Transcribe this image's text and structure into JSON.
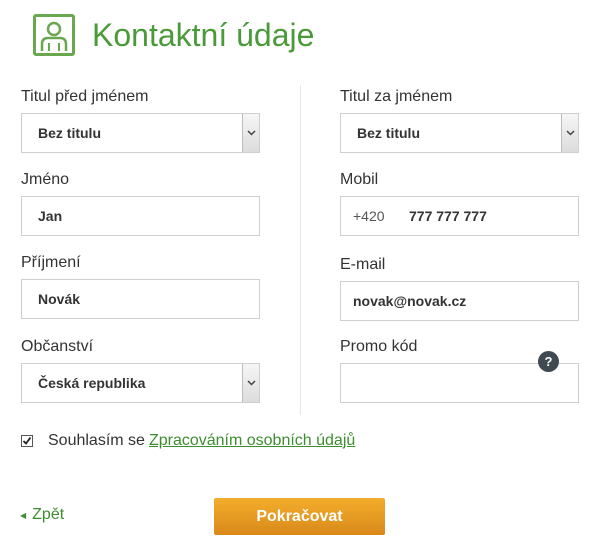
{
  "header": {
    "title": "Kontaktní údaje",
    "icon": "user-icon"
  },
  "form": {
    "title_before": {
      "label": "Titul před jménem",
      "value": "Bez titulu"
    },
    "title_after": {
      "label": "Titul za jménem",
      "value": "Bez titulu"
    },
    "first_name": {
      "label": "Jméno",
      "value": "Jan"
    },
    "mobile": {
      "label": "Mobil",
      "prefix": "+420",
      "value": "777 777 777"
    },
    "last_name": {
      "label": "Příjmení",
      "value": "Novák"
    },
    "email": {
      "label": "E-mail",
      "value": "novak@novak.cz"
    },
    "citizenship": {
      "label": "Občanství",
      "value": "Česká republika"
    },
    "promo": {
      "label": "Promo kód",
      "value": "",
      "help": "?"
    }
  },
  "consent": {
    "checked": true,
    "text": "Souhlasím se",
    "link_text": "Zpracováním osobních údajů"
  },
  "nav": {
    "back": "Zpět",
    "continue": "Pokračovat"
  },
  "colors": {
    "brand_green": "#4a9a3a",
    "link_green": "#3e8e2f",
    "button_orange": "#e79a22"
  }
}
